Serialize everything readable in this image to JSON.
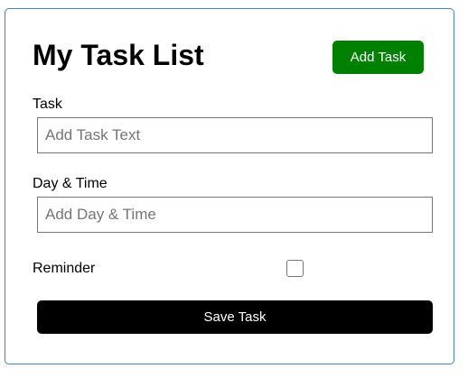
{
  "header": {
    "title": "My Task List",
    "add_button": "Add Task"
  },
  "form": {
    "task_label": "Task",
    "task_placeholder": "Add Task Text",
    "task_value": "",
    "day_label": "Day & Time",
    "day_placeholder": "Add Day & Time",
    "day_value": "",
    "reminder_label": "Reminder",
    "reminder_checked": false,
    "save_button": "Save Task"
  },
  "colors": {
    "add_button": "#008000",
    "save_button": "#000000",
    "border": "#4682b4"
  }
}
